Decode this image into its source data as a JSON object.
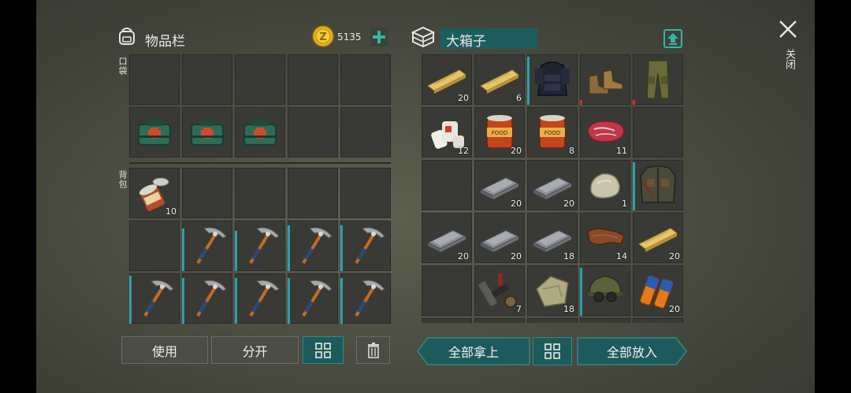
{
  "inventory": {
    "title": "物品栏",
    "coins": "5135",
    "pocket_label": "口袋",
    "backpack_label": "背包",
    "pocket_slots": [
      {
        "item": "",
        "qty": ""
      },
      {
        "item": "",
        "qty": ""
      },
      {
        "item": "",
        "qty": ""
      },
      {
        "item": "",
        "qty": ""
      },
      {
        "item": "",
        "qty": ""
      },
      {
        "item": "medkit",
        "qty": ""
      },
      {
        "item": "medkit",
        "qty": ""
      },
      {
        "item": "medkit",
        "qty": ""
      },
      {
        "item": "",
        "qty": ""
      },
      {
        "item": "",
        "qty": ""
      }
    ],
    "backpack_slots": [
      {
        "item": "open-can",
        "qty": "10"
      },
      {
        "item": "",
        "qty": ""
      },
      {
        "item": "",
        "qty": ""
      },
      {
        "item": "",
        "qty": ""
      },
      {
        "item": "",
        "qty": ""
      },
      {
        "item": "",
        "qty": ""
      },
      {
        "item": "pickaxe",
        "qty": "",
        "dura": 0.85
      },
      {
        "item": "pickaxe",
        "qty": "",
        "dura": 0.8
      },
      {
        "item": "pickaxe",
        "qty": "",
        "dura": 0.9
      },
      {
        "item": "pickaxe",
        "qty": "",
        "dura": 0.9
      },
      {
        "item": "pickaxe",
        "qty": "",
        "dura": 0.95
      },
      {
        "item": "pickaxe",
        "qty": "",
        "dura": 0.9
      },
      {
        "item": "pickaxe",
        "qty": "",
        "dura": 0.9
      },
      {
        "item": "pickaxe",
        "qty": "",
        "dura": 0.9
      },
      {
        "item": "pickaxe",
        "qty": "",
        "dura": 0.9
      }
    ],
    "use_label": "使用",
    "split_label": "分开"
  },
  "chest": {
    "title": "大箱子",
    "close_label": "关闭",
    "take_all_label": "全部拿上",
    "put_all_label": "全部放入",
    "slots": [
      {
        "item": "plank",
        "qty": "20"
      },
      {
        "item": "plank",
        "qty": "6"
      },
      {
        "item": "vest",
        "qty": "",
        "dura": 0.95
      },
      {
        "item": "boots",
        "qty": "",
        "red": true
      },
      {
        "item": "pants",
        "qty": "",
        "red": true
      },
      {
        "item": "bandage",
        "qty": "12"
      },
      {
        "item": "food-can",
        "qty": "20"
      },
      {
        "item": "food-can",
        "qty": "8"
      },
      {
        "item": "meat",
        "qty": "11"
      },
      {
        "item": "",
        "qty": ""
      },
      {
        "item": "",
        "qty": ""
      },
      {
        "item": "ingot",
        "qty": "20"
      },
      {
        "item": "ingot",
        "qty": "20"
      },
      {
        "item": "stone",
        "qty": "1"
      },
      {
        "item": "jacket",
        "qty": "",
        "dura": 0.95
      },
      {
        "item": "ingot",
        "qty": "20"
      },
      {
        "item": "ingot",
        "qty": "20"
      },
      {
        "item": "ingot",
        "qty": "18"
      },
      {
        "item": "leather",
        "qty": "14"
      },
      {
        "item": "plank",
        "qty": "20"
      },
      {
        "item": "",
        "qty": ""
      },
      {
        "item": "parts",
        "qty": "7"
      },
      {
        "item": "cloth",
        "qty": "18"
      },
      {
        "item": "helmet",
        "qty": "",
        "dura": 0.95
      },
      {
        "item": "battery",
        "qty": "20"
      }
    ]
  },
  "colors": {
    "accent": "#2e8a8a",
    "panel": "#393a35",
    "coin": "#e5b51c",
    "durability": "#2aa0ae",
    "damage": "#d0302a"
  },
  "icons": [
    "backpack-icon",
    "coin-icon",
    "plus-icon",
    "chest-icon",
    "upload-icon",
    "close-icon",
    "grid-icon",
    "trash-icon"
  ]
}
